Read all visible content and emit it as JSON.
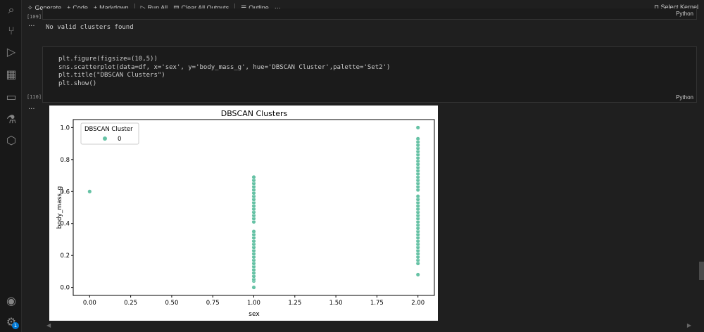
{
  "toolbar": {
    "generate": "Generate",
    "code": "Code",
    "markdown": "Markdown",
    "run_all": "Run All",
    "clear_outputs": "Clear All Outputs",
    "outline": "Outline",
    "more": "···",
    "select_kernel": "Select Kernel"
  },
  "cells": [
    {
      "exec_count": "[109]",
      "lang": "Python",
      "output": "No valid clusters found",
      "output_menu": "···"
    },
    {
      "exec_count": "[110]",
      "lang": "Python",
      "code": [
        "plt.figure(figsize=(10,5))",
        "sns.scatterplot(data=df, x='sex', y='body_mass_g', hue='DBSCAN Cluster',palette='Set2')",
        "plt.title(\"DBSCAN Clusters\")",
        "plt.show()"
      ],
      "output_menu": "···"
    }
  ],
  "activity_bar": {
    "icons": [
      "search-icon",
      "source-control-icon",
      "run-debug-icon",
      "extensions-icon",
      "remote-explorer-icon",
      "testing-icon",
      "packages-icon",
      "account-icon",
      "settings-icon"
    ],
    "settings_badge": "1"
  },
  "chart_data": {
    "type": "scatter",
    "title": "DBSCAN Clusters",
    "xlabel": "sex",
    "ylabel": "body_mass_g",
    "xlim": [
      -0.1,
      2.1
    ],
    "ylim": [
      -0.05,
      1.05
    ],
    "xticks": [
      "0.00",
      "0.25",
      "0.50",
      "0.75",
      "1.00",
      "1.25",
      "1.50",
      "1.75",
      "2.00"
    ],
    "yticks": [
      "0.0",
      "0.2",
      "0.4",
      "0.6",
      "0.8",
      "1.0"
    ],
    "legend": {
      "title": "DBSCAN Cluster",
      "entries": [
        "0"
      ],
      "placement": "upper-left"
    },
    "color": "#66c2a5",
    "grid": false,
    "series": [
      {
        "name": "0",
        "points": [
          [
            0,
            0.6
          ],
          [
            1,
            0.0
          ],
          [
            1,
            0.04
          ],
          [
            1,
            0.05
          ],
          [
            1,
            0.07
          ],
          [
            1,
            0.09
          ],
          [
            1,
            0.11
          ],
          [
            1,
            0.13
          ],
          [
            1,
            0.15
          ],
          [
            1,
            0.17
          ],
          [
            1,
            0.19
          ],
          [
            1,
            0.21
          ],
          [
            1,
            0.23
          ],
          [
            1,
            0.25
          ],
          [
            1,
            0.27
          ],
          [
            1,
            0.29
          ],
          [
            1,
            0.31
          ],
          [
            1,
            0.33
          ],
          [
            1,
            0.35
          ],
          [
            1,
            0.41
          ],
          [
            1,
            0.43
          ],
          [
            1,
            0.45
          ],
          [
            1,
            0.47
          ],
          [
            1,
            0.49
          ],
          [
            1,
            0.51
          ],
          [
            1,
            0.53
          ],
          [
            1,
            0.55
          ],
          [
            1,
            0.57
          ],
          [
            1,
            0.59
          ],
          [
            1,
            0.61
          ],
          [
            1,
            0.63
          ],
          [
            1,
            0.65
          ],
          [
            1,
            0.67
          ],
          [
            1,
            0.69
          ],
          [
            2,
            0.08
          ],
          [
            2,
            0.15
          ],
          [
            2,
            0.17
          ],
          [
            2,
            0.19
          ],
          [
            2,
            0.21
          ],
          [
            2,
            0.23
          ],
          [
            2,
            0.25
          ],
          [
            2,
            0.27
          ],
          [
            2,
            0.29
          ],
          [
            2,
            0.31
          ],
          [
            2,
            0.33
          ],
          [
            2,
            0.35
          ],
          [
            2,
            0.37
          ],
          [
            2,
            0.39
          ],
          [
            2,
            0.41
          ],
          [
            2,
            0.43
          ],
          [
            2,
            0.45
          ],
          [
            2,
            0.47
          ],
          [
            2,
            0.49
          ],
          [
            2,
            0.51
          ],
          [
            2,
            0.53
          ],
          [
            2,
            0.55
          ],
          [
            2,
            0.57
          ],
          [
            2,
            0.61
          ],
          [
            2,
            0.63
          ],
          [
            2,
            0.65
          ],
          [
            2,
            0.67
          ],
          [
            2,
            0.69
          ],
          [
            2,
            0.71
          ],
          [
            2,
            0.73
          ],
          [
            2,
            0.75
          ],
          [
            2,
            0.77
          ],
          [
            2,
            0.79
          ],
          [
            2,
            0.81
          ],
          [
            2,
            0.83
          ],
          [
            2,
            0.85
          ],
          [
            2,
            0.87
          ],
          [
            2,
            0.89
          ],
          [
            2,
            0.91
          ],
          [
            2,
            0.93
          ],
          [
            2,
            1.0
          ]
        ]
      }
    ]
  }
}
